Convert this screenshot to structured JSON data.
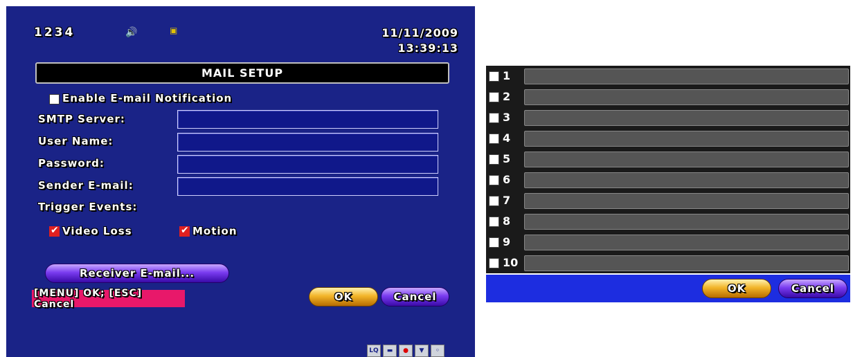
{
  "header": {
    "channels": "1234",
    "date": "11/11/2009",
    "time": "13:39:13",
    "icons": [
      "audio-icon",
      "record-icon"
    ]
  },
  "mail_setup": {
    "title": "MAIL SETUP",
    "enable_label": "Enable E-mail Notification",
    "enable_checked": false,
    "smtp_label": "SMTP Server:",
    "smtp_value": "",
    "user_label": "User Name:",
    "user_value": "",
    "password_label": "Password:",
    "password_value": "",
    "sender_label": "Sender E-mail:",
    "sender_value": "",
    "trigger_label": "Trigger Events:",
    "video_loss_label": "Video Loss",
    "video_loss_checked": true,
    "motion_label": "Motion",
    "motion_checked": true,
    "receiver_button": "Receiver E-mail...",
    "hint": "[MENU] OK; [ESC] Cancel",
    "ok_label": "OK",
    "cancel_label": "Cancel"
  },
  "status_bar": {
    "icons": [
      "lq-icon",
      "display-icon",
      "record-status-icon",
      "shield-icon",
      "camera-icon"
    ],
    "lq_text": "LQ"
  },
  "receiver_list": {
    "rows": [
      {
        "num": "1",
        "value": "",
        "checked": false
      },
      {
        "num": "2",
        "value": "",
        "checked": false
      },
      {
        "num": "3",
        "value": "",
        "checked": false
      },
      {
        "num": "4",
        "value": "",
        "checked": false
      },
      {
        "num": "5",
        "value": "",
        "checked": false
      },
      {
        "num": "6",
        "value": "",
        "checked": false
      },
      {
        "num": "7",
        "value": "",
        "checked": false
      },
      {
        "num": "8",
        "value": "",
        "checked": false
      },
      {
        "num": "9",
        "value": "",
        "checked": false
      },
      {
        "num": "10",
        "value": "",
        "checked": false
      }
    ],
    "ok_label": "OK",
    "cancel_label": "Cancel"
  },
  "colors": {
    "background": "#1a2387",
    "hint_bar": "#e8186a",
    "list_footer": "#1d2de0",
    "checkmark": "#e02020"
  }
}
